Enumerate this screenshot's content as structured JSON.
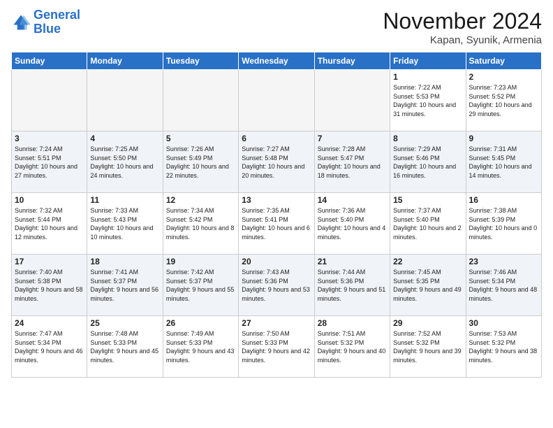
{
  "logo": {
    "line1": "General",
    "line2": "Blue"
  },
  "header": {
    "month": "November 2024",
    "location": "Kapan, Syunik, Armenia"
  },
  "weekdays": [
    "Sunday",
    "Monday",
    "Tuesday",
    "Wednesday",
    "Thursday",
    "Friday",
    "Saturday"
  ],
  "weeks": [
    [
      {
        "day": "",
        "empty": true
      },
      {
        "day": "",
        "empty": true
      },
      {
        "day": "",
        "empty": true
      },
      {
        "day": "",
        "empty": true
      },
      {
        "day": "",
        "empty": true
      },
      {
        "day": "1",
        "sunrise": "Sunrise: 7:22 AM",
        "sunset": "Sunset: 5:53 PM",
        "daylight": "Daylight: 10 hours and 31 minutes."
      },
      {
        "day": "2",
        "sunrise": "Sunrise: 7:23 AM",
        "sunset": "Sunset: 5:52 PM",
        "daylight": "Daylight: 10 hours and 29 minutes."
      }
    ],
    [
      {
        "day": "3",
        "sunrise": "Sunrise: 7:24 AM",
        "sunset": "Sunset: 5:51 PM",
        "daylight": "Daylight: 10 hours and 27 minutes."
      },
      {
        "day": "4",
        "sunrise": "Sunrise: 7:25 AM",
        "sunset": "Sunset: 5:50 PM",
        "daylight": "Daylight: 10 hours and 24 minutes."
      },
      {
        "day": "5",
        "sunrise": "Sunrise: 7:26 AM",
        "sunset": "Sunset: 5:49 PM",
        "daylight": "Daylight: 10 hours and 22 minutes."
      },
      {
        "day": "6",
        "sunrise": "Sunrise: 7:27 AM",
        "sunset": "Sunset: 5:48 PM",
        "daylight": "Daylight: 10 hours and 20 minutes."
      },
      {
        "day": "7",
        "sunrise": "Sunrise: 7:28 AM",
        "sunset": "Sunset: 5:47 PM",
        "daylight": "Daylight: 10 hours and 18 minutes."
      },
      {
        "day": "8",
        "sunrise": "Sunrise: 7:29 AM",
        "sunset": "Sunset: 5:46 PM",
        "daylight": "Daylight: 10 hours and 16 minutes."
      },
      {
        "day": "9",
        "sunrise": "Sunrise: 7:31 AM",
        "sunset": "Sunset: 5:45 PM",
        "daylight": "Daylight: 10 hours and 14 minutes."
      }
    ],
    [
      {
        "day": "10",
        "sunrise": "Sunrise: 7:32 AM",
        "sunset": "Sunset: 5:44 PM",
        "daylight": "Daylight: 10 hours and 12 minutes."
      },
      {
        "day": "11",
        "sunrise": "Sunrise: 7:33 AM",
        "sunset": "Sunset: 5:43 PM",
        "daylight": "Daylight: 10 hours and 10 minutes."
      },
      {
        "day": "12",
        "sunrise": "Sunrise: 7:34 AM",
        "sunset": "Sunset: 5:42 PM",
        "daylight": "Daylight: 10 hours and 8 minutes."
      },
      {
        "day": "13",
        "sunrise": "Sunrise: 7:35 AM",
        "sunset": "Sunset: 5:41 PM",
        "daylight": "Daylight: 10 hours and 6 minutes."
      },
      {
        "day": "14",
        "sunrise": "Sunrise: 7:36 AM",
        "sunset": "Sunset: 5:40 PM",
        "daylight": "Daylight: 10 hours and 4 minutes."
      },
      {
        "day": "15",
        "sunrise": "Sunrise: 7:37 AM",
        "sunset": "Sunset: 5:40 PM",
        "daylight": "Daylight: 10 hours and 2 minutes."
      },
      {
        "day": "16",
        "sunrise": "Sunrise: 7:38 AM",
        "sunset": "Sunset: 5:39 PM",
        "daylight": "Daylight: 10 hours and 0 minutes."
      }
    ],
    [
      {
        "day": "17",
        "sunrise": "Sunrise: 7:40 AM",
        "sunset": "Sunset: 5:38 PM",
        "daylight": "Daylight: 9 hours and 58 minutes."
      },
      {
        "day": "18",
        "sunrise": "Sunrise: 7:41 AM",
        "sunset": "Sunset: 5:37 PM",
        "daylight": "Daylight: 9 hours and 56 minutes."
      },
      {
        "day": "19",
        "sunrise": "Sunrise: 7:42 AM",
        "sunset": "Sunset: 5:37 PM",
        "daylight": "Daylight: 9 hours and 55 minutes."
      },
      {
        "day": "20",
        "sunrise": "Sunrise: 7:43 AM",
        "sunset": "Sunset: 5:36 PM",
        "daylight": "Daylight: 9 hours and 53 minutes."
      },
      {
        "day": "21",
        "sunrise": "Sunrise: 7:44 AM",
        "sunset": "Sunset: 5:36 PM",
        "daylight": "Daylight: 9 hours and 51 minutes."
      },
      {
        "day": "22",
        "sunrise": "Sunrise: 7:45 AM",
        "sunset": "Sunset: 5:35 PM",
        "daylight": "Daylight: 9 hours and 49 minutes."
      },
      {
        "day": "23",
        "sunrise": "Sunrise: 7:46 AM",
        "sunset": "Sunset: 5:34 PM",
        "daylight": "Daylight: 9 hours and 48 minutes."
      }
    ],
    [
      {
        "day": "24",
        "sunrise": "Sunrise: 7:47 AM",
        "sunset": "Sunset: 5:34 PM",
        "daylight": "Daylight: 9 hours and 46 minutes."
      },
      {
        "day": "25",
        "sunrise": "Sunrise: 7:48 AM",
        "sunset": "Sunset: 5:33 PM",
        "daylight": "Daylight: 9 hours and 45 minutes."
      },
      {
        "day": "26",
        "sunrise": "Sunrise: 7:49 AM",
        "sunset": "Sunset: 5:33 PM",
        "daylight": "Daylight: 9 hours and 43 minutes."
      },
      {
        "day": "27",
        "sunrise": "Sunrise: 7:50 AM",
        "sunset": "Sunset: 5:33 PM",
        "daylight": "Daylight: 9 hours and 42 minutes."
      },
      {
        "day": "28",
        "sunrise": "Sunrise: 7:51 AM",
        "sunset": "Sunset: 5:32 PM",
        "daylight": "Daylight: 9 hours and 40 minutes."
      },
      {
        "day": "29",
        "sunrise": "Sunrise: 7:52 AM",
        "sunset": "Sunset: 5:32 PM",
        "daylight": "Daylight: 9 hours and 39 minutes."
      },
      {
        "day": "30",
        "sunrise": "Sunrise: 7:53 AM",
        "sunset": "Sunset: 5:32 PM",
        "daylight": "Daylight: 9 hours and 38 minutes."
      }
    ]
  ]
}
